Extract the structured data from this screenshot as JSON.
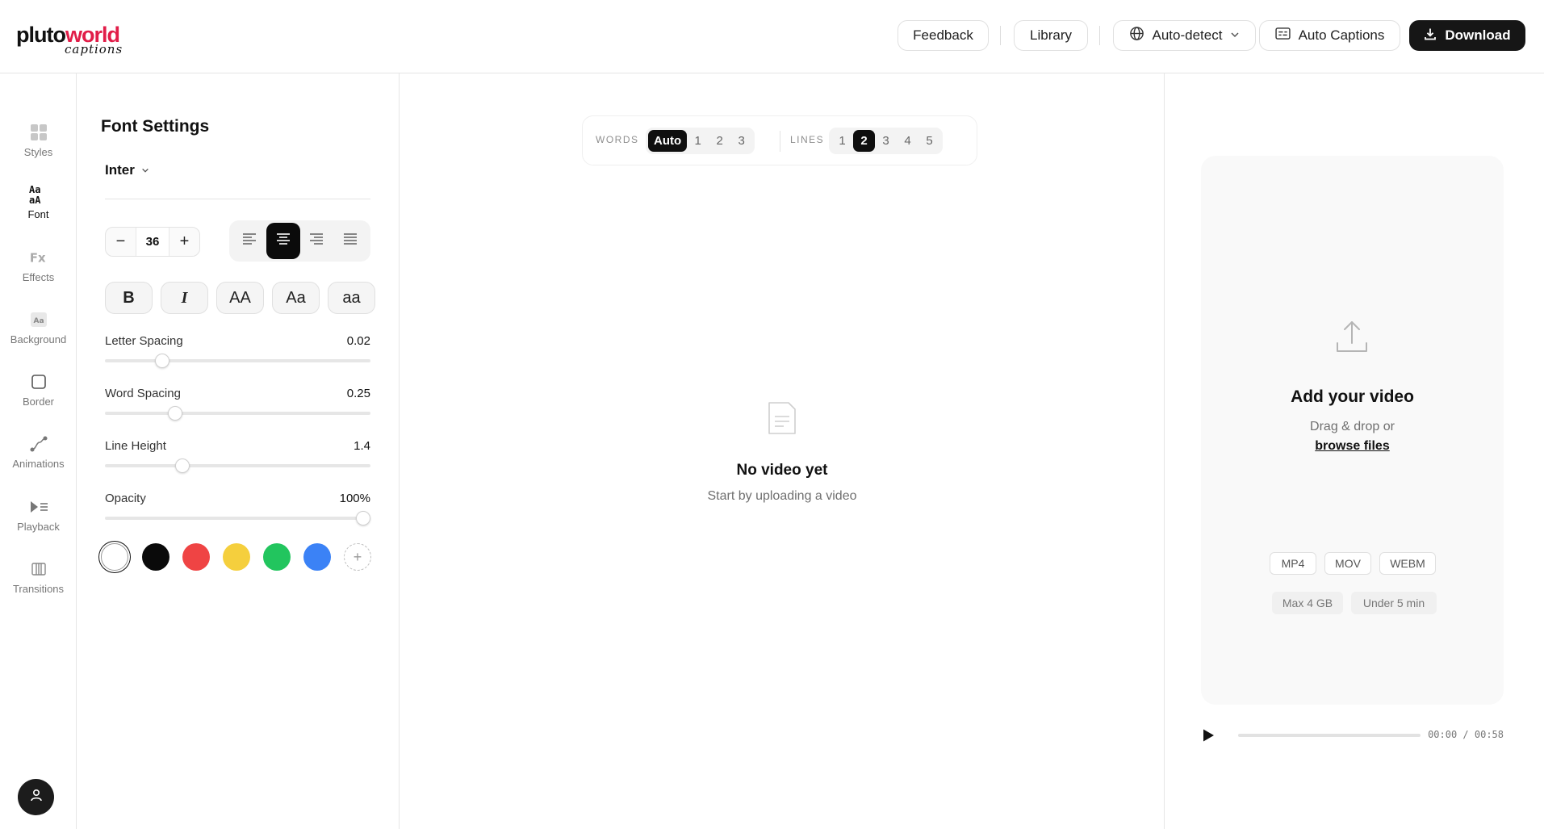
{
  "brand": {
    "name_part1": "pluto",
    "name_part2": "world",
    "tagline": "captions",
    "accent": "#e11d48"
  },
  "header": {
    "feedback_label": "Feedback",
    "library_label": "Library",
    "language_label": "Auto-detect",
    "auto_captions_label": "Auto Captions",
    "download_label": "Download"
  },
  "rail": {
    "items": [
      {
        "label": "Styles",
        "icon": "styles-grid-icon",
        "active": false
      },
      {
        "label": "Font",
        "icon": "font-icon",
        "active": true
      },
      {
        "label": "Effects",
        "icon": "effects-fx-icon",
        "active": false
      },
      {
        "label": "Background",
        "icon": "background-icon",
        "active": false
      },
      {
        "label": "Border",
        "icon": "border-icon",
        "active": false
      },
      {
        "label": "Animations",
        "icon": "animations-icon",
        "active": false
      },
      {
        "label": "Playback",
        "icon": "playback-icon",
        "active": false
      },
      {
        "label": "Transitions",
        "icon": "transitions-icon",
        "active": false
      }
    ]
  },
  "font_settings": {
    "title": "Font Settings",
    "font_family": "Inter",
    "font_size": "36",
    "text_align": "center",
    "style_buttons": [
      "B",
      "I",
      "AA",
      "Aa",
      "aa"
    ],
    "letter_spacing": {
      "label": "Letter Spacing",
      "value": "0.02",
      "fraction": 0.2
    },
    "word_spacing": {
      "label": "Word Spacing",
      "value": "0.25",
      "fraction": 0.25
    },
    "line_height": {
      "label": "Line Height",
      "value": "1.4",
      "fraction": 0.28
    },
    "opacity": {
      "label": "Opacity",
      "value": "100%",
      "fraction": 1.0
    },
    "colors": [
      "#ffffff",
      "#0a0a0a",
      "#ef4444",
      "#f5cf3d",
      "#22c55e",
      "#3b82f6"
    ],
    "selected_color": "#ffffff",
    "add_color_symbol": "+"
  },
  "caption_options": {
    "words_label": "WORDS",
    "words_options": [
      "Auto",
      "1",
      "2",
      "3"
    ],
    "words_selected": "Auto",
    "lines_label": "LINES",
    "lines_options": [
      "1",
      "2",
      "3",
      "4",
      "5"
    ],
    "lines_selected": "2"
  },
  "preview": {
    "empty_title": "No video yet",
    "empty_subtitle": "Start by uploading a video"
  },
  "upload": {
    "title": "Add your video",
    "subtitle": "Drag & drop or",
    "browse_link": "browse files",
    "formats": [
      "MP4",
      "MOV",
      "WEBM"
    ],
    "limits": [
      "Max 4 GB",
      "Under 5 min"
    ]
  },
  "player": {
    "time": "00:00 / 00:58",
    "progress": 0
  }
}
